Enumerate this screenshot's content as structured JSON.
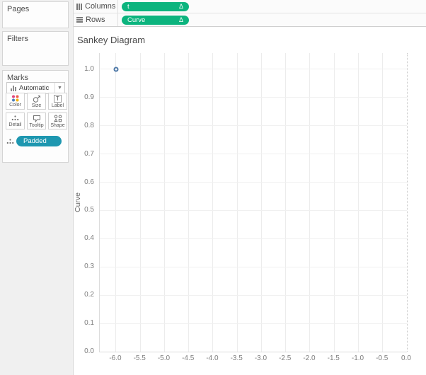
{
  "sidebar": {
    "pages": {
      "label": "Pages"
    },
    "filters": {
      "label": "Filters"
    },
    "marks": {
      "label": "Marks",
      "mark_type_selector": "Automatic",
      "buttons": [
        {
          "label": "Color",
          "icon": "color-dots-icon"
        },
        {
          "label": "Size",
          "icon": "size-circle-icon"
        },
        {
          "label": "Label",
          "icon": "label-t-icon"
        },
        {
          "label": "Detail",
          "icon": "detail-dots-icon"
        },
        {
          "label": "Tooltip",
          "icon": "tooltip-bubble-icon"
        },
        {
          "label": "Shape",
          "icon": "shapes-icon"
        }
      ],
      "encoding_pill": {
        "label": "Padded",
        "role": "detail"
      }
    }
  },
  "shelves": {
    "columns": {
      "label": "Columns",
      "pill": {
        "label": "t",
        "modifier": "Δ"
      }
    },
    "rows": {
      "label": "Rows",
      "pill": {
        "label": "Curve",
        "modifier": "Δ"
      }
    }
  },
  "sheet": {
    "title": "Sankey Diagram"
  },
  "chart_data": {
    "type": "scatter",
    "title": "Sankey Diagram",
    "xlabel": "",
    "ylabel": "Curve",
    "points": [
      {
        "x": -6.0,
        "y": 1.0
      }
    ],
    "xlim": [
      -6.335,
      0.0
    ],
    "ylim": [
      0.0,
      1.0575
    ],
    "x_ticks": [
      -6.0,
      -5.5,
      -5.0,
      -4.5,
      -4.0,
      -3.5,
      -3.0,
      -2.5,
      -2.0,
      -1.5,
      -1.0,
      -0.5,
      0.0
    ],
    "y_ticks": [
      0.0,
      0.1,
      0.2,
      0.3,
      0.4,
      0.5,
      0.6,
      0.7,
      0.8,
      0.9,
      1.0
    ],
    "grid": true,
    "legend_position": "none",
    "marker": {
      "shape": "open-circle",
      "color": "#4e79a7"
    }
  },
  "colors": {
    "measure_pill_green": "#0cb47e",
    "detail_pill_teal": "#1e97b0",
    "marker_blue": "#4e79a7",
    "sidebar_bg": "#f0f0f0"
  }
}
